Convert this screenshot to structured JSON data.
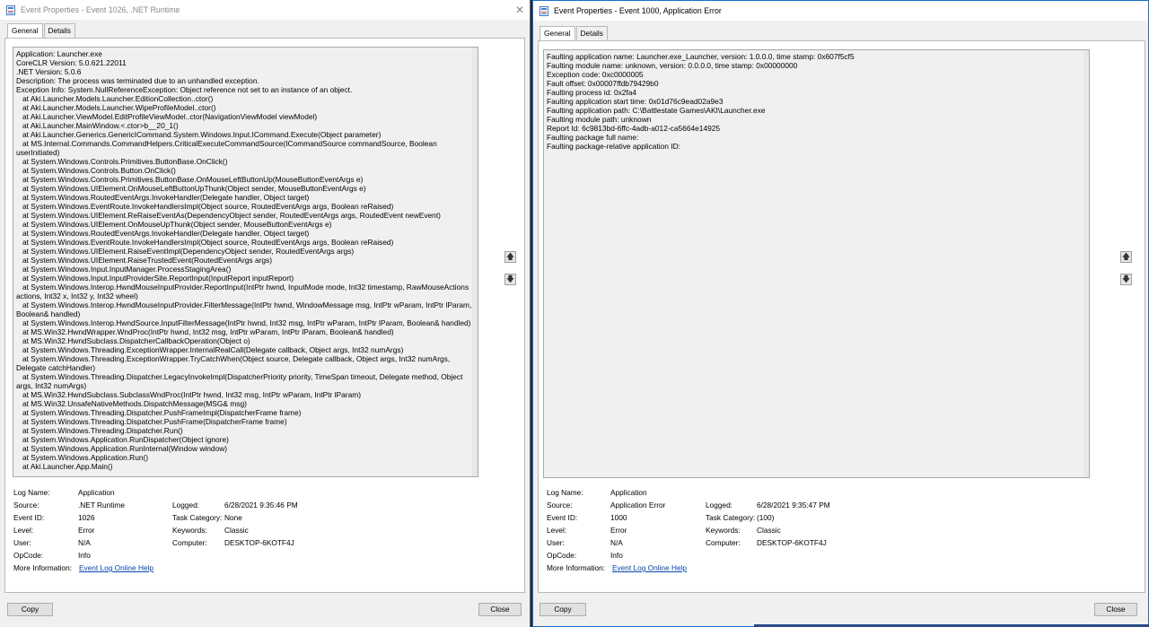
{
  "left_window": {
    "title": "Event Properties - Event 1026, .NET Runtime",
    "tabs": [
      "General",
      "Details"
    ],
    "description": "Application: Launcher.exe\nCoreCLR Version: 5.0.621.22011\n.NET Version: 5.0.6\nDescription: The process was terminated due to an unhandled exception.\nException Info: System.NullReferenceException: Object reference not set to an instance of an object.\n   at Aki.Launcher.Models.Launcher.EditionCollection..ctor()\n   at Aki.Launcher.Models.Launcher.WipeProfileModel..ctor()\n   at Aki.Launcher.ViewModel.EditProfileViewModel..ctor(NavigationViewModel viewModel)\n   at Aki.Launcher.MainWindow.<.ctor>b__20_1()\n   at Aki.Launcher.Generics.GenericICommand.System.Windows.Input.ICommand.Execute(Object parameter)\n   at MS.Internal.Commands.CommandHelpers.CriticalExecuteCommandSource(ICommandSource commandSource, Boolean userInitiated)\n   at System.Windows.Controls.Primitives.ButtonBase.OnClick()\n   at System.Windows.Controls.Button.OnClick()\n   at System.Windows.Controls.Primitives.ButtonBase.OnMouseLeftButtonUp(MouseButtonEventArgs e)\n   at System.Windows.UIElement.OnMouseLeftButtonUpThunk(Object sender, MouseButtonEventArgs e)\n   at System.Windows.RoutedEventArgs.InvokeHandler(Delegate handler, Object target)\n   at System.Windows.EventRoute.InvokeHandlersImpl(Object source, RoutedEventArgs args, Boolean reRaised)\n   at System.Windows.UIElement.ReRaiseEventAs(DependencyObject sender, RoutedEventArgs args, RoutedEvent newEvent)\n   at System.Windows.UIElement.OnMouseUpThunk(Object sender, MouseButtonEventArgs e)\n   at System.Windows.RoutedEventArgs.InvokeHandler(Delegate handler, Object target)\n   at System.Windows.EventRoute.InvokeHandlersImpl(Object source, RoutedEventArgs args, Boolean reRaised)\n   at System.Windows.UIElement.RaiseEventImpl(DependencyObject sender, RoutedEventArgs args)\n   at System.Windows.UIElement.RaiseTrustedEvent(RoutedEventArgs args)\n   at System.Windows.Input.InputManager.ProcessStagingArea()\n   at System.Windows.Input.InputProviderSite.ReportInput(InputReport inputReport)\n   at System.Windows.Interop.HwndMouseInputProvider.ReportInput(IntPtr hwnd, InputMode mode, Int32 timestamp, RawMouseActions actions, Int32 x, Int32 y, Int32 wheel)\n   at System.Windows.Interop.HwndMouseInputProvider.FilterMessage(IntPtr hwnd, WindowMessage msg, IntPtr wParam, IntPtr lParam, Boolean& handled)\n   at System.Windows.Interop.HwndSource.InputFilterMessage(IntPtr hwnd, Int32 msg, IntPtr wParam, IntPtr lParam, Boolean& handled)\n   at MS.Win32.HwndWrapper.WndProc(IntPtr hwnd, Int32 msg, IntPtr wParam, IntPtr lParam, Boolean& handled)\n   at MS.Win32.HwndSubclass.DispatcherCallbackOperation(Object o)\n   at System.Windows.Threading.ExceptionWrapper.InternalRealCall(Delegate callback, Object args, Int32 numArgs)\n   at System.Windows.Threading.ExceptionWrapper.TryCatchWhen(Object source, Delegate callback, Object args, Int32 numArgs, Delegate catchHandler)\n   at System.Windows.Threading.Dispatcher.LegacyInvokeImpl(DispatcherPriority priority, TimeSpan timeout, Delegate method, Object args, Int32 numArgs)\n   at MS.Win32.HwndSubclass.SubclassWndProc(IntPtr hwnd, Int32 msg, IntPtr wParam, IntPtr lParam)\n   at MS.Win32.UnsafeNativeMethods.DispatchMessage(MSG& msg)\n   at System.Windows.Threading.Dispatcher.PushFrameImpl(DispatcherFrame frame)\n   at System.Windows.Threading.Dispatcher.PushFrame(DispatcherFrame frame)\n   at System.Windows.Threading.Dispatcher.Run()\n   at System.Windows.Application.RunDispatcher(Object ignore)\n   at System.Windows.Application.RunInternal(Window window)\n   at System.Windows.Application.Run()\n   at Aki.Launcher.App.Main()",
    "labels": {
      "log_name": "Log Name:",
      "source": "Source:",
      "event_id": "Event ID:",
      "level": "Level:",
      "user": "User:",
      "opcode": "OpCode:",
      "more_info": "More Information:",
      "logged": "Logged:",
      "task_category": "Task Category:",
      "keywords": "Keywords:",
      "computer": "Computer:"
    },
    "values": {
      "log_name": "Application",
      "source": ".NET Runtime",
      "event_id": "1026",
      "level": "Error",
      "user": "N/A",
      "opcode": "Info",
      "more_info_link": "Event Log Online Help",
      "logged": "6/28/2021 9:35:46 PM",
      "task_category": "None",
      "keywords": "Classic",
      "computer": "DESKTOP-6KOTF4J"
    },
    "buttons": {
      "copy": "Copy",
      "close": "Close"
    }
  },
  "right_window": {
    "title": "Event Properties - Event 1000, Application Error",
    "tabs": [
      "General",
      "Details"
    ],
    "description": "Faulting application name: Launcher.exe_Launcher, version: 1.0.0.0, time stamp: 0x607f5cf5\nFaulting module name: unknown, version: 0.0.0.0, time stamp: 0x00000000\nException code: 0xc0000005\nFault offset: 0x00007ffdb79429b0\nFaulting process id: 0x2fa4\nFaulting application start time: 0x01d76c9ead02a9e3\nFaulting application path: C:\\Battlestate Games\\AKI\\Launcher.exe\nFaulting module path: unknown\nReport Id: 6c9813bd-6ffc-4adb-a012-ca5664e14925\nFaulting package full name: \nFaulting package-relative application ID: ",
    "labels": {
      "log_name": "Log Name:",
      "source": "Source:",
      "event_id": "Event ID:",
      "level": "Level:",
      "user": "User:",
      "opcode": "OpCode:",
      "more_info": "More Information:",
      "logged": "Logged:",
      "task_category": "Task Category:",
      "keywords": "Keywords:",
      "computer": "Computer:"
    },
    "values": {
      "log_name": "Application",
      "source": "Application Error",
      "event_id": "1000",
      "level": "Error",
      "user": "N/A",
      "opcode": "Info",
      "more_info_link": "Event Log Online Help",
      "logged": "6/28/2021 9:35:47 PM",
      "task_category": "(100)",
      "keywords": "Classic",
      "computer": "DESKTOP-6KOTF4J"
    },
    "buttons": {
      "copy": "Copy",
      "close": "Close"
    }
  },
  "icons": {
    "close": "✕",
    "arrow_up": "🡅",
    "arrow_down": "🡇"
  },
  "colors": {
    "link": "#0645ad",
    "active_border": "#1a6fc8"
  }
}
